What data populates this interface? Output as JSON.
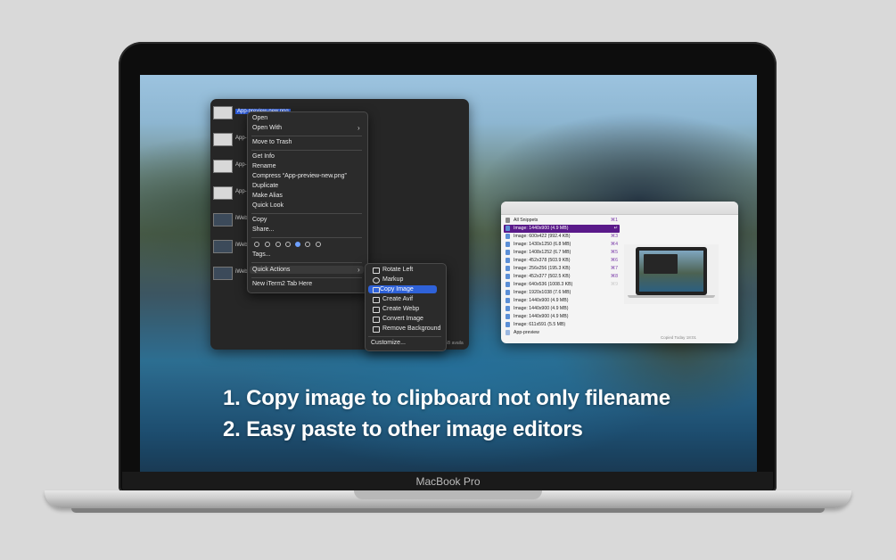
{
  "captions": {
    "line1": "1. Copy image to clipboard not only filename",
    "line2": "2. Easy paste to other image editors"
  },
  "laptop": {
    "brand": "MacBook Pro"
  },
  "finder": {
    "files": [
      {
        "name": "App-preview-new.png",
        "selected": true
      },
      {
        "name": "App-"
      },
      {
        "name": "App-"
      },
      {
        "name": "App-"
      },
      {
        "name": "iWeb"
      },
      {
        "name": "iWeb"
      },
      {
        "name": "iWeb"
      }
    ],
    "status": "GB availa"
  },
  "context_menu": {
    "items": [
      "Open",
      "Open With",
      "Move to Trash",
      "Get Info",
      "Rename",
      "Compress “App-preview-new.png”",
      "Duplicate",
      "Make Alias",
      "Quick Look",
      "Copy",
      "Share...",
      "Tags...",
      "Quick Actions",
      "New iTerm2 Tab Here"
    ]
  },
  "quick_actions": {
    "items": [
      {
        "label": "Rotate Left",
        "icon": "rotate-left-icon"
      },
      {
        "label": "Markup",
        "icon": "markup-icon"
      },
      {
        "label": "Copy Image",
        "icon": "copy-image-icon",
        "highlighted": true
      },
      {
        "label": "Create Avif",
        "icon": "workflow-icon"
      },
      {
        "label": "Create Webp",
        "icon": "workflow-icon"
      },
      {
        "label": "Convert Image",
        "icon": "convert-image-icon"
      },
      {
        "label": "Remove Background",
        "icon": "remove-background-icon"
      }
    ],
    "customize": "Customize..."
  },
  "snippets": {
    "items": [
      {
        "label": "All Snippets",
        "key": "⌘1"
      },
      {
        "label": "Image: 1440x900 (4.9 MB)",
        "key": "↵",
        "selected": true
      },
      {
        "label": "Image: 600x422 (992.4 KB)",
        "key": "⌘3"
      },
      {
        "label": "Image: 1430x1250 (6.8 MB)",
        "key": "⌘4"
      },
      {
        "label": "Image: 1408x1252 (6.7 MB)",
        "key": "⌘5"
      },
      {
        "label": "Image: 452x378 (503.9 KB)",
        "key": "⌘6"
      },
      {
        "label": "Image: 256x256 (195.3 KB)",
        "key": "⌘7"
      },
      {
        "label": "Image: 452x377 (502.5 KB)",
        "key": "⌘8"
      },
      {
        "label": "Image: 640x536 (1008.3 KB)",
        "key": "⌘9"
      },
      {
        "label": "Image: 1920x1038 (7.6 MB)",
        "key": ""
      },
      {
        "label": "Image: 1440x900 (4.9 MB)",
        "key": ""
      },
      {
        "label": "Image: 1440x900 (4.9 MB)",
        "key": ""
      },
      {
        "label": "Image: 1440x900 (4.9 MB)",
        "key": ""
      },
      {
        "label": "Image: 611x591 (5.5 MB)",
        "key": ""
      },
      {
        "label": "App-preview",
        "key": ""
      }
    ],
    "copied": "Copied Today 18:01"
  },
  "colors": {
    "selection": "#2f62d9",
    "snippet_selection": "#5a1a8a"
  }
}
